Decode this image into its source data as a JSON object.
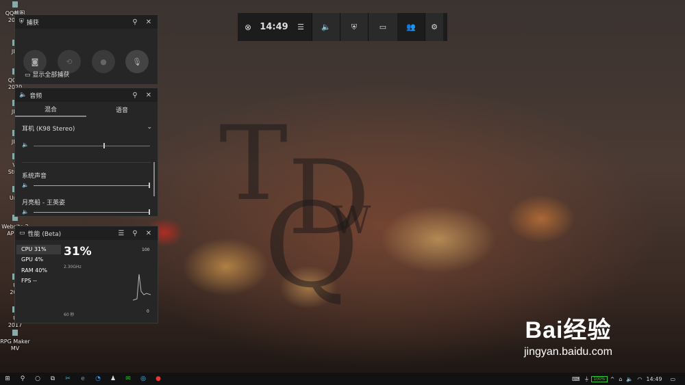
{
  "capture_panel": {
    "title": "捕获",
    "show_all_label": "显示全部捕获",
    "icons": [
      "screenshot-icon",
      "record-last-icon",
      "record-icon",
      "mic-off-icon"
    ]
  },
  "audio_panel": {
    "title": "音频",
    "tabs": [
      "混合",
      "语音"
    ],
    "device": "耳机 (K98 Stereo)",
    "apps": [
      {
        "name": "系统声音",
        "level": 1.0
      },
      {
        "name": "月亮船 - 王英姿",
        "level": 1.0
      }
    ],
    "device_level": 0.6
  },
  "perf_panel": {
    "title": "性能 (Beta)",
    "stats": [
      {
        "label": "CPU",
        "value": "31%"
      },
      {
        "label": "GPU",
        "value": "4%"
      },
      {
        "label": "RAM",
        "value": "40%"
      },
      {
        "label": "FPS",
        "value": "--"
      }
    ],
    "big_value": "31%",
    "freq": "2.30GHz",
    "max": "100",
    "min": "0",
    "duration": "60 秒"
  },
  "gamebar": {
    "time": "14:49"
  },
  "desktop_icons": [
    {
      "label": "QQ截图\n2020"
    },
    {
      "label": "JIA"
    },
    {
      "label": "QQ截\n2020"
    },
    {
      "label": "JIA"
    },
    {
      "label": "JIA"
    },
    {
      "label": "Vi\nStudi"
    },
    {
      "label": "Unit"
    },
    {
      "label": "Website 2\nAPK B"
    },
    {
      "label": "U\n201"
    },
    {
      "label": "U\n2017"
    },
    {
      "label": "RPG Maker\nMV"
    }
  ],
  "watermark": {
    "brand": "Bai经验",
    "url": "jingyan.baidu.com"
  },
  "taskbar": {
    "time": "14:49",
    "battery": "100%"
  }
}
